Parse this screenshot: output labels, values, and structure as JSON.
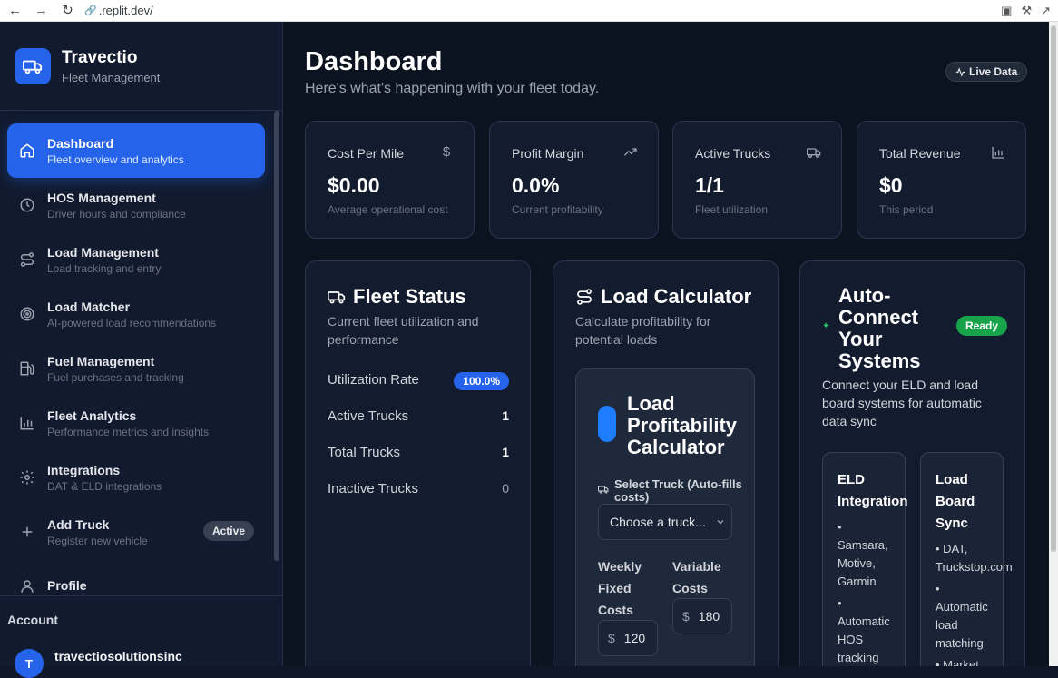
{
  "browser": {
    "url": ".replit.dev/"
  },
  "sidebar": {
    "brand_title": "Travectio",
    "brand_subtitle": "Fleet Management",
    "items": [
      {
        "label": "Dashboard",
        "desc": "Fleet overview and analytics",
        "icon": "home-icon",
        "active": true
      },
      {
        "label": "HOS Management",
        "desc": "Driver hours and compliance",
        "icon": "clock-icon"
      },
      {
        "label": "Load Management",
        "desc": "Load tracking and entry",
        "icon": "route-icon"
      },
      {
        "label": "Load Matcher",
        "desc": "AI-powered load recommendations",
        "icon": "target-icon"
      },
      {
        "label": "Fuel Management",
        "desc": "Fuel purchases and tracking",
        "icon": "fuel-icon"
      },
      {
        "label": "Fleet Analytics",
        "desc": "Performance metrics and insights",
        "icon": "bar-chart-icon"
      },
      {
        "label": "Integrations",
        "desc": "DAT & ELD integrations",
        "icon": "gear-icon"
      },
      {
        "label": "Add Truck",
        "desc": "Register new vehicle",
        "icon": "plus-icon",
        "badge": "Active"
      },
      {
        "label": "Profile",
        "desc": "",
        "icon": "user-icon"
      }
    ],
    "account_label": "Account",
    "avatar_initial": "T",
    "account_name": "travectiosolutionsinc"
  },
  "header": {
    "title": "Dashboard",
    "subtitle": "Here's what's happening with your fleet today.",
    "live_badge": "Live Data"
  },
  "stats": [
    {
      "label": "Cost Per Mile",
      "value": "$0.00",
      "caption": "Average operational cost",
      "icon": "dollar-icon"
    },
    {
      "label": "Profit Margin",
      "value": "0.0%",
      "caption": "Current profitability",
      "icon": "trending-up-icon"
    },
    {
      "label": "Active Trucks",
      "value": "1/1",
      "caption": "Fleet utilization",
      "icon": "truck-icon"
    },
    {
      "label": "Total Revenue",
      "value": "$0",
      "caption": "This period",
      "icon": "bar-chart-icon"
    }
  ],
  "fleet_status": {
    "title": "Fleet Status",
    "desc": "Current fleet utilization and performance",
    "rows": [
      {
        "label": "Utilization Rate",
        "value": "100.0%"
      },
      {
        "label": "Active Trucks",
        "value": "1"
      },
      {
        "label": "Total Trucks",
        "value": "1"
      },
      {
        "label": "Inactive Trucks",
        "value": "0"
      }
    ]
  },
  "load_calculator": {
    "title": "Load Calculator",
    "desc": "Calculate profitability for potential loads",
    "inner_title": "Load Profitability Calculator",
    "select_label": "Select Truck (Auto-fills costs)",
    "select_value": "Choose a truck...",
    "weekly_label": "Weekly Fixed Costs",
    "weekly_value": "120",
    "variable_label": "Variable Costs",
    "variable_value": "180",
    "currency": "$"
  },
  "auto_connect": {
    "title": "Auto-Connect Your Systems",
    "badge": "Ready",
    "desc": "Connect your ELD and load board systems for automatic data sync",
    "eld": {
      "title": "ELD Integration",
      "bullets": [
        "Samsara, Motive, Garmin",
        "Automatic HOS tracking"
      ]
    },
    "load_board": {
      "title": "Load Board Sync",
      "bullets": [
        "DAT, Truckstop.com",
        "Automatic load matching",
        "Market"
      ]
    }
  }
}
